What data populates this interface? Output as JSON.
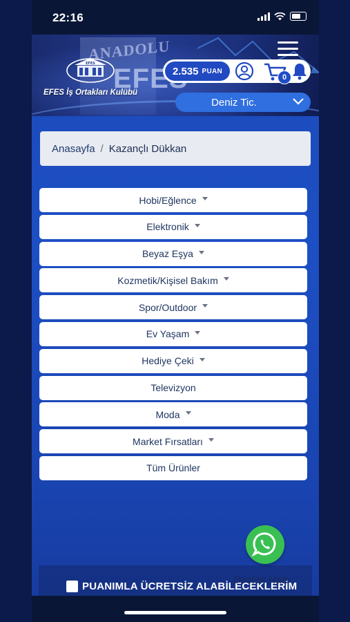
{
  "status_bar": {
    "time": "22:16"
  },
  "header": {
    "background_sign_top": "ANADOLU",
    "background_sign_bottom": "EFES",
    "logo_text": "EFES İş Ortakları Kulübü",
    "logo_small_text": "EFES",
    "points": {
      "value": "2.535",
      "unit": "PUAN"
    },
    "cart_count": "0",
    "dealer_name": "Deniz Tic."
  },
  "breadcrumb": {
    "home": "Anasayfa",
    "separator": "/",
    "current": "Kazançlı Dükkan"
  },
  "categories": [
    {
      "label": "Hobi/Eğlence",
      "has_dropdown": true
    },
    {
      "label": "Elektronik",
      "has_dropdown": true
    },
    {
      "label": "Beyaz Eşya",
      "has_dropdown": true
    },
    {
      "label": "Kozmetik/Kişisel Bakım",
      "has_dropdown": true
    },
    {
      "label": "Spor/Outdoor",
      "has_dropdown": true
    },
    {
      "label": "Ev Yaşam",
      "has_dropdown": true
    },
    {
      "label": "Hediye Çeki",
      "has_dropdown": true
    },
    {
      "label": "Televizyon",
      "has_dropdown": false
    },
    {
      "label": "Moda",
      "has_dropdown": true
    },
    {
      "label": "Market Fırsatları",
      "has_dropdown": true
    },
    {
      "label": "Tüm Ürünler",
      "has_dropdown": false
    }
  ],
  "support": {
    "label": "Destek Hattı"
  },
  "footer": {
    "title": "PUANIMLA ÜCRETSİZ ALABİLECEKLERİM"
  },
  "colors": {
    "page_background": "#1d4fc4",
    "points_pill": "#2149c2",
    "dealer_select": "#2f6fe0",
    "whatsapp": "#3ac052"
  }
}
